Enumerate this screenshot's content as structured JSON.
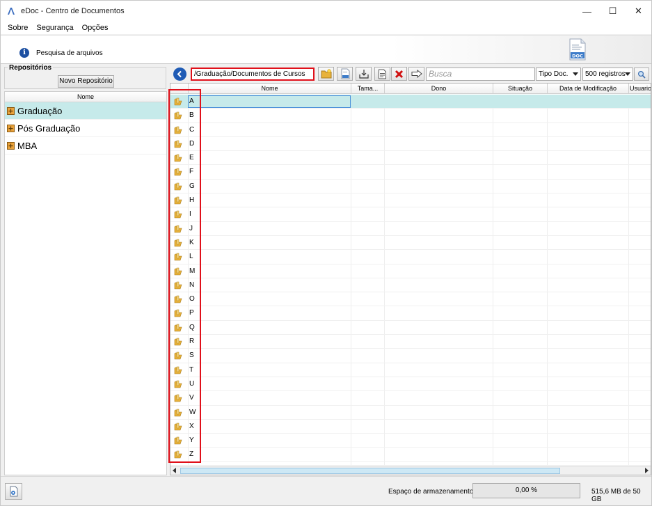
{
  "window": {
    "title": "eDoc - Centro de Documentos",
    "minimize": "—",
    "maximize": "☐",
    "close": "✕"
  },
  "menu": {
    "items": [
      {
        "label": "Sobre"
      },
      {
        "label": "Segurança"
      },
      {
        "label": "Opções"
      }
    ]
  },
  "banner": {
    "text": "Pesquisa de arquivos",
    "logo_text": "DOC"
  },
  "left": {
    "group_title": "Repositórios",
    "new_repo_button": "Novo Repositório",
    "tree_header": "Nome",
    "items": [
      {
        "label": "Graduação",
        "selected": true
      },
      {
        "label": "Pós Graduação",
        "selected": false
      },
      {
        "label": "MBA",
        "selected": false
      }
    ]
  },
  "toolbar": {
    "path": "/Graduação/Documentos de Cursos",
    "search_placeholder": "Busca",
    "doc_type": "Tipo Doc.",
    "records": "500 registros"
  },
  "grid": {
    "columns": [
      "Nome",
      "Tama...",
      "Dono",
      "Situação",
      "Data de Modificação",
      "Usuario"
    ],
    "rows": [
      "A",
      "B",
      "C",
      "D",
      "E",
      "F",
      "G",
      "H",
      "I",
      "J",
      "K",
      "L",
      "M",
      "N",
      "O",
      "P",
      "Q",
      "R",
      "S",
      "T",
      "U",
      "V",
      "W",
      "X",
      "Y",
      "Z"
    ],
    "selected_index": 0
  },
  "footer": {
    "storage_label": "Espaço de armazenamento:",
    "storage_percent_text": "0,00 %",
    "storage_fraction": 0.0,
    "storage_used": "515,6 MB  de 50 GB"
  },
  "colors": {
    "selection": "#c6eaea",
    "highlight_box": "#e0101a",
    "accent_blue": "#1f5bb5",
    "folder": "#e8b23a",
    "progress": "#06b025"
  }
}
